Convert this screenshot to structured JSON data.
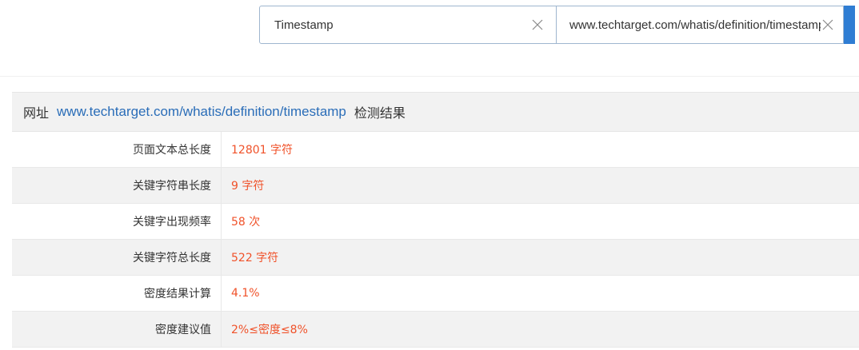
{
  "search": {
    "keyword_value": "Timestamp",
    "url_value": "www.techtarget.com/whatis/definition/timestamp"
  },
  "result": {
    "header_prefix": "网址",
    "url": "www.techtarget.com/whatis/definition/timestamp",
    "header_suffix": "检测结果",
    "rows": [
      {
        "label": "页面文本总长度",
        "value": "12801 字符"
      },
      {
        "label": "关键字符串长度",
        "value": "9 字符"
      },
      {
        "label": "关键字出现频率",
        "value": "58 次"
      },
      {
        "label": "关键字符总长度",
        "value": "522 字符"
      },
      {
        "label": "密度结果计算",
        "value": "4.1%"
      },
      {
        "label": "密度建议值",
        "value": "2%≤密度≤8%"
      }
    ]
  },
  "colors": {
    "accent": "#2f7dd3",
    "link": "#2a6db8",
    "value": "#f0522a"
  },
  "icons": {
    "clear": "close-icon"
  }
}
